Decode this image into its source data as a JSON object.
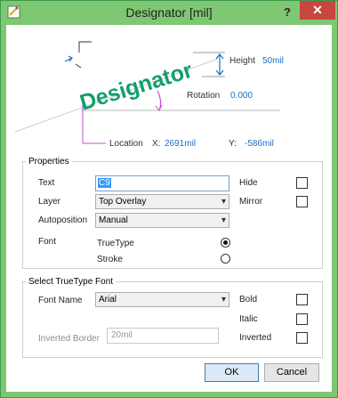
{
  "window": {
    "title": "Designator [mil]",
    "help_glyph": "?",
    "close_glyph": "✕"
  },
  "graphic": {
    "designator_text": "Designator",
    "height_label": "Height",
    "height_value": "50mil",
    "rotation_label": "Rotation",
    "rotation_value": "0.000",
    "location_label": "Location",
    "x_label": "X:",
    "x_value": "2691mil",
    "y_label": "Y:",
    "y_value": "-586mil",
    "accent_color": "#119e6b",
    "guide_color": "#c44fd0"
  },
  "properties": {
    "legend": "Properties",
    "text_label": "Text",
    "text_value": "C9",
    "layer_label": "Layer",
    "layer_value": "Top Overlay",
    "autoposition_label": "Autoposition",
    "autoposition_value": "Manual",
    "font_label": "Font",
    "font_truetype_label": "TrueType",
    "font_stroke_label": "Stroke",
    "font_selected": "TrueType",
    "hide_label": "Hide",
    "mirror_label": "Mirror"
  },
  "truetype": {
    "legend": "Select TrueType Font",
    "font_name_label": "Font Name",
    "font_name_value": "Arial",
    "bold_label": "Bold",
    "italic_label": "Italic",
    "inverted_label": "Inverted",
    "inverted_border_label": "Inverted Border",
    "inverted_border_value": "20mil"
  },
  "buttons": {
    "ok": "OK",
    "cancel": "Cancel"
  }
}
